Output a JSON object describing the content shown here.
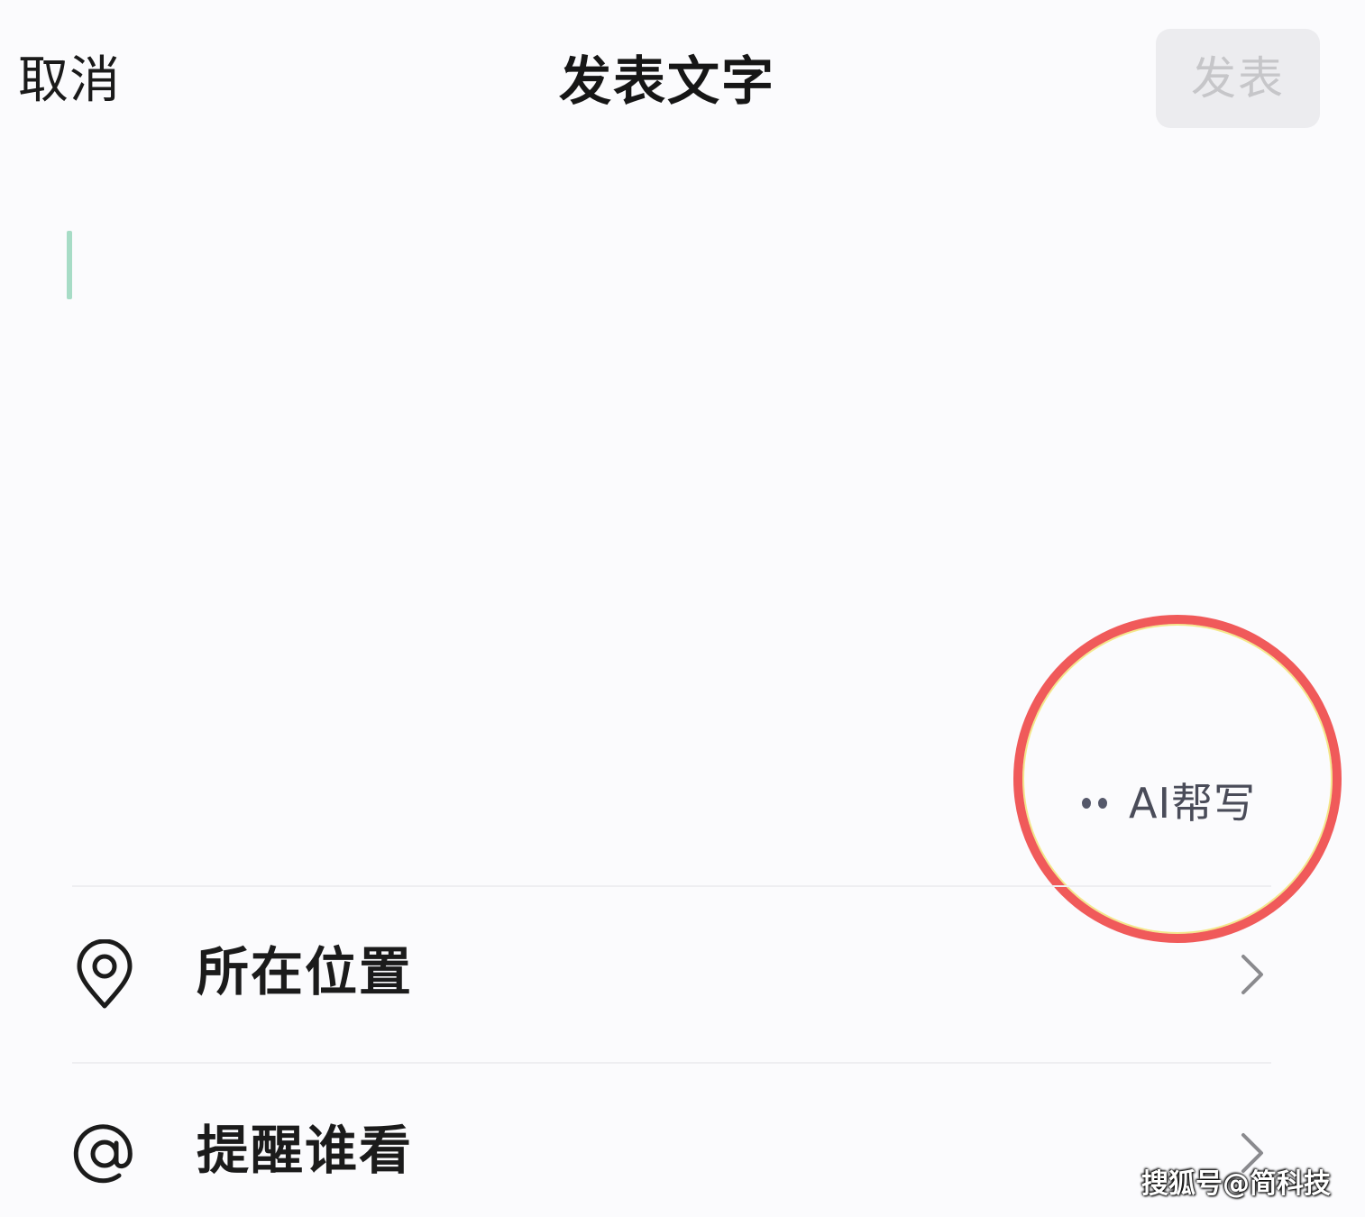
{
  "header": {
    "cancel_label": "取消",
    "title": "发表文字",
    "publish_label": "发表"
  },
  "editor": {
    "value": ""
  },
  "ai_help": {
    "label": "AI帮写",
    "icon": "dots-icon"
  },
  "options": [
    {
      "label": "所在位置",
      "icon": "location-pin-icon"
    },
    {
      "label": "提醒谁看",
      "icon": "at-sign-icon"
    }
  ],
  "watermark": "搜狐号@简科技",
  "colors": {
    "background": "#fbfbfd",
    "cursor": "#a7dcc6",
    "publish_bg": "#ececef",
    "publish_text": "#c6c6c9",
    "highlight_circle": "#f05a5a"
  }
}
